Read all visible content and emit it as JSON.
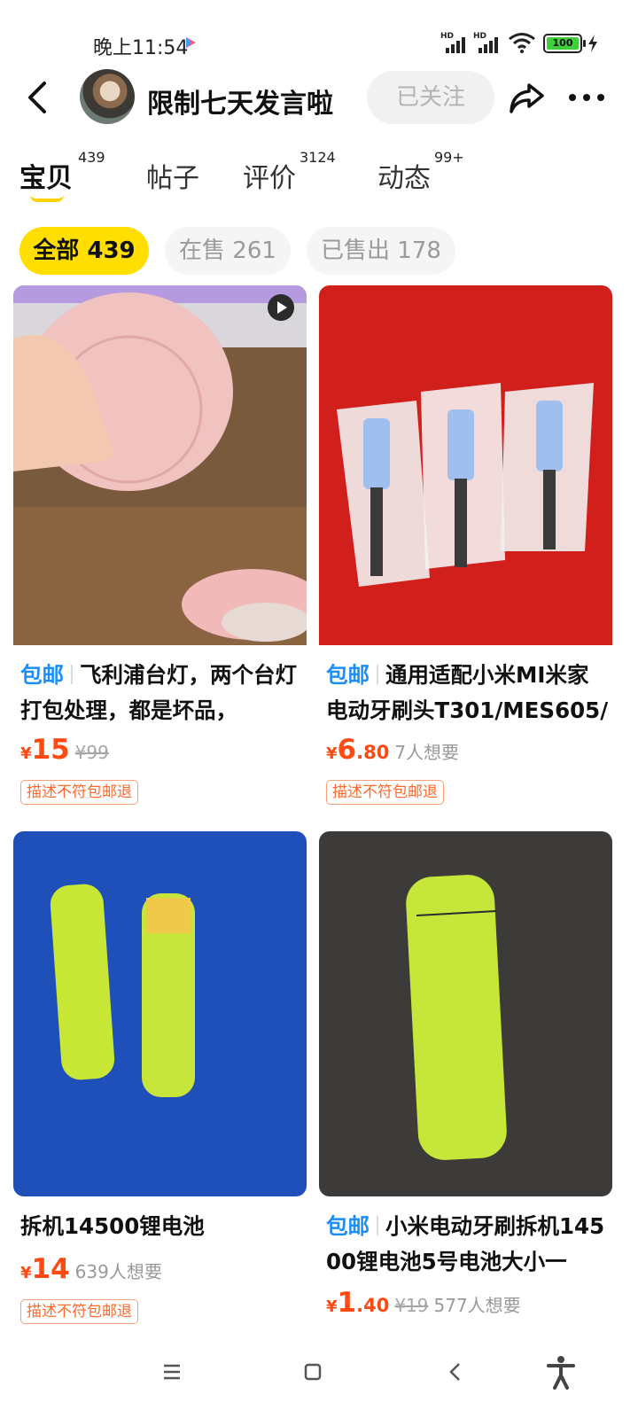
{
  "status_bar": {
    "time": "晚上11:54",
    "signal_1": "HD",
    "signal_2": "HD",
    "battery": "100",
    "icons": [
      "play-icon",
      "signal-icon",
      "signal-icon",
      "wifi-icon",
      "battery-icon",
      "charging-icon"
    ]
  },
  "header": {
    "shop_name": "限制七天发言啦",
    "follow_label": "已关注",
    "icons": [
      "back-icon",
      "avatar",
      "share-icon",
      "more-icon"
    ]
  },
  "tabs": [
    {
      "label": "宝贝",
      "count": "439",
      "active": true
    },
    {
      "label": "帖子",
      "count": "",
      "active": false
    },
    {
      "label": "评价",
      "count": "3124",
      "active": false
    },
    {
      "label": "动态",
      "count": "99+",
      "active": false
    }
  ],
  "filters": [
    {
      "label": "全部 439",
      "active": true
    },
    {
      "label": "在售 261",
      "active": false
    },
    {
      "label": "已售出 178",
      "active": false
    }
  ],
  "products": [
    {
      "tag": "包邮",
      "title": "飞利浦台灯，两个台灯打包处理，都是坏品，",
      "price_symbol": "¥",
      "price_int": "15",
      "price_dec": "",
      "original_price": "¥99",
      "wants": "",
      "badge": "描述不符包邮退",
      "has_video": true
    },
    {
      "tag": "包邮",
      "title": "通用适配小米MI米家电动牙刷头T301/MES605/",
      "price_symbol": "¥",
      "price_int": "6",
      "price_dec": ".80",
      "original_price": "",
      "wants": "7人想要",
      "badge": "描述不符包邮退",
      "has_video": false
    },
    {
      "tag": "",
      "title": "拆机14500锂电池",
      "price_symbol": "¥",
      "price_int": "14",
      "price_dec": "",
      "original_price": "",
      "wants": "639人想要",
      "badge": "描述不符包邮退",
      "has_video": false
    },
    {
      "tag": "包邮",
      "title": "小米电动牙刷拆机14500锂电池5号电池大小一",
      "price_symbol": "¥",
      "price_int": "1",
      "price_dec": ".40",
      "original_price": "¥19",
      "wants": "577人想要",
      "badge": "",
      "has_video": false
    }
  ],
  "nav_bar": {
    "icons": [
      "menu-icon",
      "home-icon",
      "back-icon",
      "accessibility-icon"
    ]
  },
  "colors": {
    "accent_yellow": "#ffde00",
    "price_orange": "#ff4b12",
    "tag_blue": "#1b8ef7"
  }
}
